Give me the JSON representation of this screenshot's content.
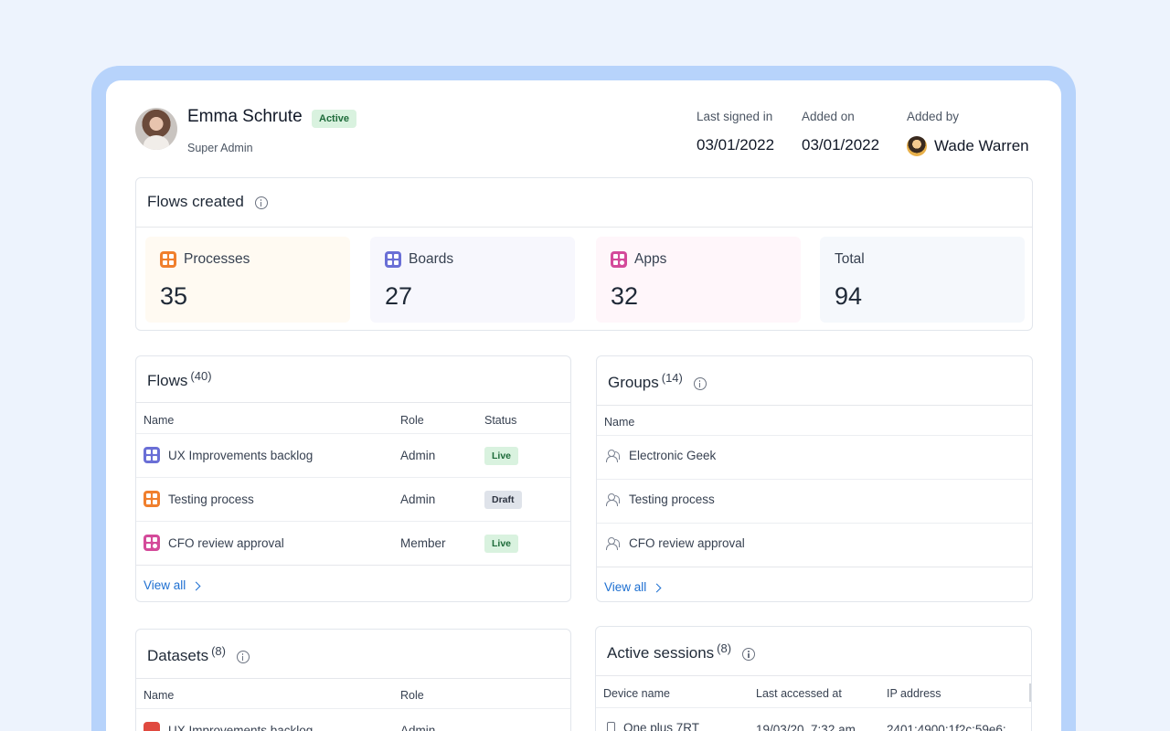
{
  "user": {
    "name": "Emma Schrute",
    "status": "Active",
    "role": "Super Admin",
    "meta": [
      {
        "label": "Last signed in",
        "value": "03/01/2022"
      },
      {
        "label": "Added on",
        "value": "03/01/2022"
      },
      {
        "label": "Added by",
        "value": "Wade Warren"
      }
    ]
  },
  "flows_created": {
    "title": "Flows created",
    "stats": [
      {
        "label": "Processes",
        "value": "35",
        "icon": "processes-icon",
        "color": "#f07f2d",
        "bg": "#fffaf2"
      },
      {
        "label": "Boards",
        "value": "27",
        "icon": "boards-icon",
        "color": "#6a6fd6",
        "bg": "#f7f7fd"
      },
      {
        "label": "Apps",
        "value": "32",
        "icon": "apps-icon",
        "color": "#d44a9a",
        "bg": "#fff6fa"
      },
      {
        "label": "Total",
        "value": "94",
        "bg": "#f5f8fc"
      }
    ]
  },
  "flows": {
    "title": "Flows",
    "count": "(40)",
    "columns": [
      "Name",
      "Role",
      "Status"
    ],
    "rows": [
      {
        "name": "UX Improvements backlog",
        "role": "Admin",
        "status": "Live",
        "icon": "boards-icon"
      },
      {
        "name": "Testing process",
        "role": "Admin",
        "status": "Draft",
        "icon": "processes-icon"
      },
      {
        "name": "CFO review approval",
        "role": "Member",
        "status": "Live",
        "icon": "apps-icon"
      }
    ],
    "view_all": "View all"
  },
  "groups": {
    "title": "Groups",
    "count": "(14)",
    "columns": [
      "Name"
    ],
    "rows": [
      {
        "name": "Electronic Geek"
      },
      {
        "name": "Testing process"
      },
      {
        "name": "CFO review approval"
      }
    ],
    "view_all": "View all"
  },
  "datasets": {
    "title": "Datasets",
    "count": "(8)",
    "columns": [
      "Name",
      "Role"
    ],
    "rows": [
      {
        "name": "UX Improvements backlog",
        "role": "Admin"
      }
    ]
  },
  "sessions": {
    "title": "Active sessions",
    "count": "(8)",
    "columns": [
      "Device name",
      "Last accessed at",
      "IP address"
    ],
    "rows": [
      {
        "device": "One plus 7RT",
        "accessed": "19/03/20, 7:32 am",
        "ip": "2401:4900:1f2c:59e6:"
      }
    ]
  }
}
